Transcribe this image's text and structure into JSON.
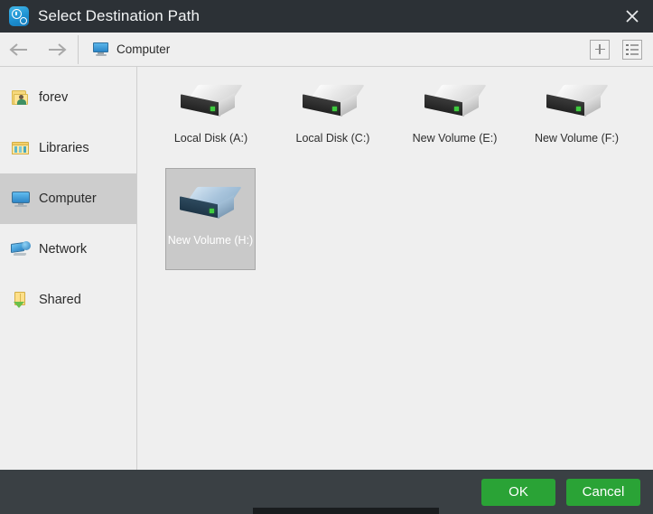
{
  "window": {
    "title": "Select Destination Path",
    "app_icon": "clock-gear-icon",
    "close_label": "×"
  },
  "toolbar": {
    "back_label": "Back",
    "forward_label": "Forward",
    "breadcrumb": "Computer",
    "breadcrumb_icon": "monitor-icon",
    "new_folder_label": "+",
    "view_mode_label": "List view"
  },
  "sidebar": {
    "items": [
      {
        "label": "forev",
        "icon": "user-folder-icon",
        "selected": false
      },
      {
        "label": "Libraries",
        "icon": "libraries-icon",
        "selected": false
      },
      {
        "label": "Computer",
        "icon": "computer-icon",
        "selected": true
      },
      {
        "label": "Network",
        "icon": "network-icon",
        "selected": false
      },
      {
        "label": "Shared",
        "icon": "shared-folder-icon",
        "selected": false
      }
    ]
  },
  "files": {
    "drives": [
      {
        "label": "Local Disk (A:)",
        "icon": "hard-drive-icon",
        "selected": false
      },
      {
        "label": "Local Disk (C:)",
        "icon": "hard-drive-icon",
        "selected": false
      },
      {
        "label": "New Volume (E:)",
        "icon": "hard-drive-icon",
        "selected": false
      },
      {
        "label": "New Volume (F:)",
        "icon": "hard-drive-icon",
        "selected": false
      },
      {
        "label": "New Volume (H:)",
        "icon": "hard-drive-icon",
        "selected": true
      }
    ]
  },
  "footer": {
    "ok_label": "OK",
    "cancel_label": "Cancel"
  },
  "colors": {
    "titlebar": "#2c3136",
    "footer": "#3a4044",
    "accent_green": "#2aa336",
    "content_bg": "#efefef",
    "selection": "#cdcdcd"
  }
}
